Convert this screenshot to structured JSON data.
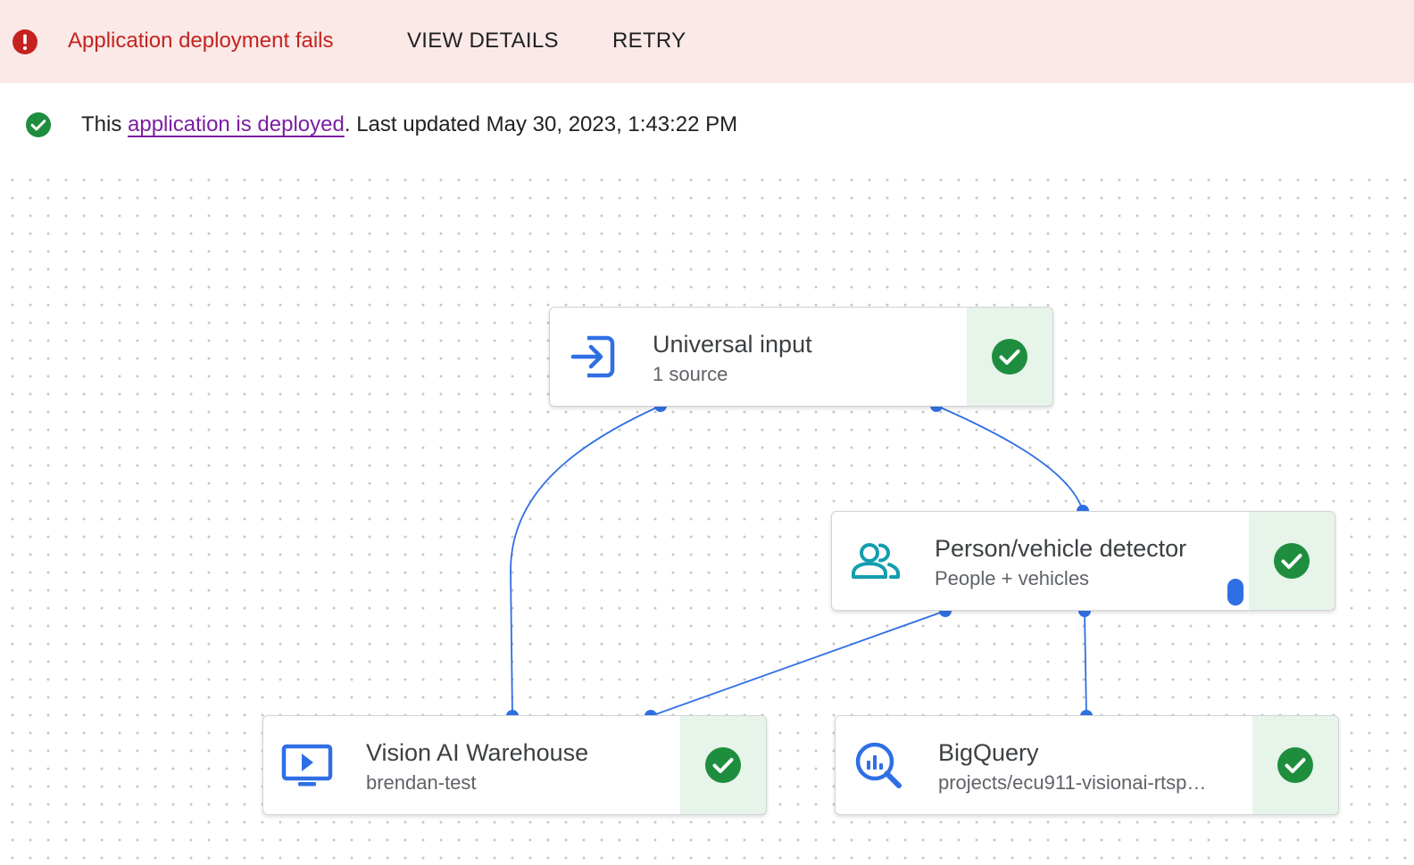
{
  "banner": {
    "message": "Application deployment fails",
    "view_details_label": "VIEW DETAILS",
    "retry_label": "RETRY",
    "icon": "error-icon",
    "color": "#c5221f",
    "background": "#fae9e7"
  },
  "status": {
    "prefix": "This ",
    "link_text": "application is deployed",
    "suffix": ". Last updated May 30, 2023, 1:43:22 PM",
    "icon": "check-circle-icon",
    "color": "#1e8e3e"
  },
  "nodes": {
    "universal_input": {
      "title": "Universal input",
      "subtitle": "1 source",
      "icon": "input-icon",
      "status": "deployed"
    },
    "person_vehicle_detector": {
      "title": "Person/vehicle detector",
      "subtitle": "People + vehicles",
      "icon": "people-icon",
      "status": "deployed"
    },
    "vision_ai_warehouse": {
      "title": "Vision AI Warehouse",
      "subtitle": "brendan-test",
      "icon": "video-monitor-icon",
      "status": "deployed"
    },
    "bigquery": {
      "title": "BigQuery",
      "subtitle": "projects/ecu911-visionai-rtsp…",
      "icon": "bigquery-icon",
      "status": "deployed"
    }
  },
  "edges": [
    {
      "from": "Universal input",
      "to": "Vision AI Warehouse"
    },
    {
      "from": "Universal input",
      "to": "Person/vehicle detector"
    },
    {
      "from": "Person/vehicle detector",
      "to": "Vision AI Warehouse"
    },
    {
      "from": "Person/vehicle detector",
      "to": "BigQuery"
    }
  ],
  "colors": {
    "edge": "#2f6fe4",
    "status_bg": "#e6f4ea",
    "check": "#1e8e3e",
    "link": "#7b1fa2"
  }
}
